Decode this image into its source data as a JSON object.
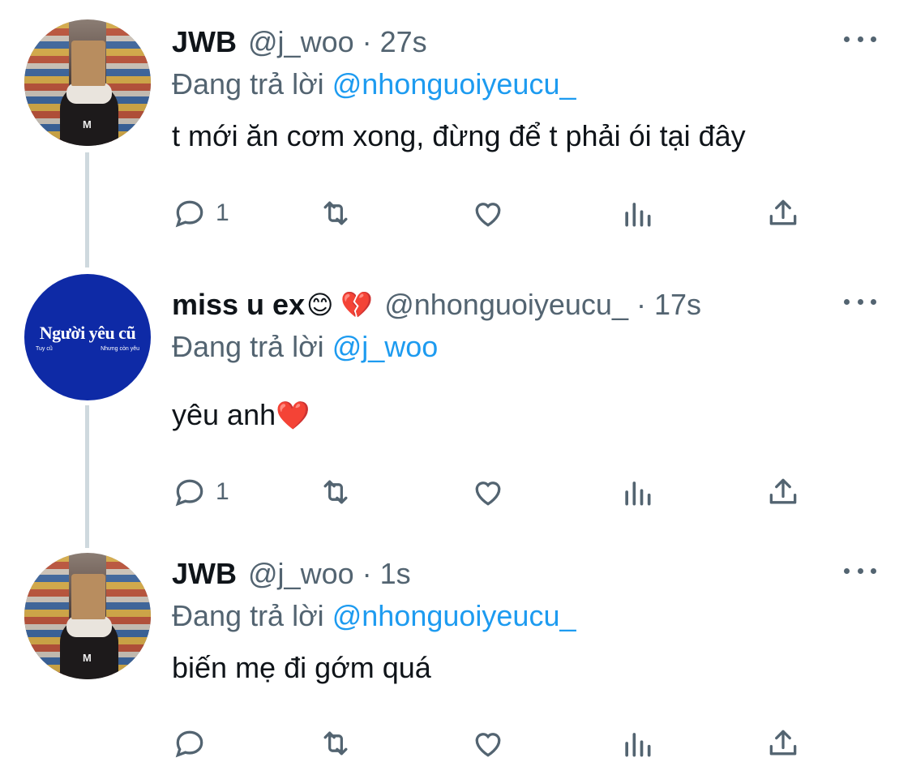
{
  "tweets": [
    {
      "name": "JWB",
      "handle": "@j_woo",
      "time": "27s",
      "reply_prefix": "Đang trả lời",
      "reply_to": "@nhonguoiyeucu_",
      "text": "t mới ăn cơm xong, đừng để t phải ói tại đây",
      "reply_count": "1",
      "avatar": "bag-head-photo"
    },
    {
      "name": "miss u ex",
      "name_emoji": "😊 💔",
      "handle": "@nhonguoiyeucu_",
      "time": "17s",
      "reply_prefix": "Đang trả lời",
      "reply_to": "@j_woo",
      "text": "yêu anh",
      "text_emoji": "❤️",
      "reply_count": "1",
      "avatar": "logo",
      "logo_main": "Người yêu cũ",
      "logo_left": "Tuy cũ",
      "logo_right": "Nhưng còn yêu"
    },
    {
      "name": "JWB",
      "handle": "@j_woo",
      "time": "1s",
      "reply_prefix": "Đang trả lời",
      "reply_to": "@nhonguoiyeucu_",
      "text": "biến mẹ đi gớm quá",
      "reply_count": "",
      "avatar": "bag-head-photo"
    }
  ],
  "dot": "·",
  "colors": {
    "mention": "#1d9bf0",
    "muted": "#536471",
    "line": "#cfd9de",
    "logo_bg": "#0e2aa6"
  }
}
